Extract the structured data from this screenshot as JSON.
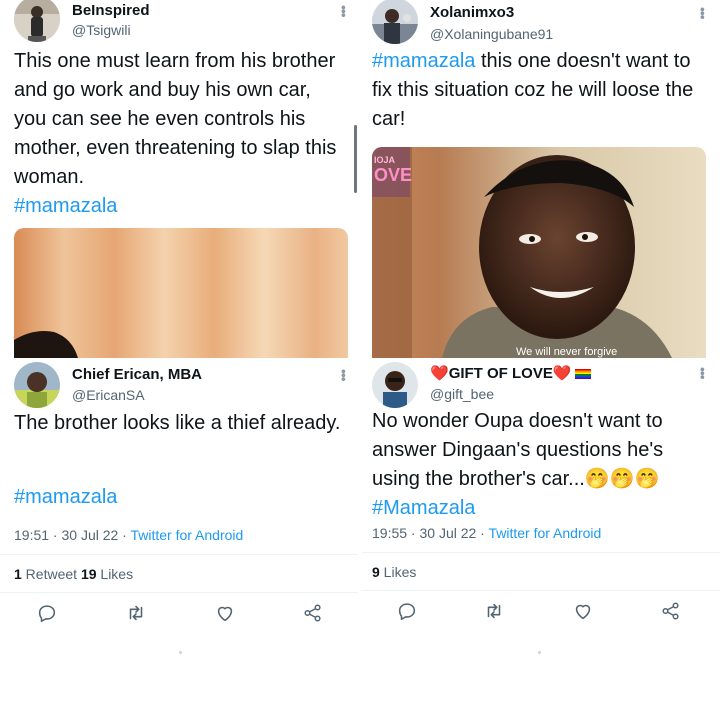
{
  "left": {
    "tweet1": {
      "name": "BeInspired",
      "handle": "@Tsigwili",
      "text": "This one must learn from his brother and go work and buy his own car, you can see he even controls his mother, even threatening to slap this woman.",
      "hashtag": "#mamazala"
    },
    "tweet2": {
      "name": "Chief Erican, MBA",
      "handle": "@EricanSA",
      "text": "The brother looks like a thief already.",
      "hashtag": "#mamazala",
      "time": "19:51 · 30 Jul 22 · ",
      "client": "Twitter for Android",
      "retweets": "1",
      "retweets_label": " Retweet  ",
      "likes": "19",
      "likes_label": " Likes"
    }
  },
  "right": {
    "tweet1": {
      "name": "Xolanimxo3",
      "handle": "@Xolaningubane91",
      "hashtag": "#mamazala",
      "text": " this one doesn't want to fix this situation coz he will loose the car!",
      "video_logo_top": "IOJA",
      "video_logo_bottom": "OVE",
      "video_caption": "We will never forgive"
    },
    "tweet2": {
      "name_prefix": "❤️",
      "name": "GIFT OF LOVE",
      "name_suffix": "❤️",
      "handle": "@gift_bee",
      "text": "No wonder Oupa doesn't want to answer Dingaan's questions he's using the brother's car...",
      "emoji": "🤭🤭🤭",
      "hashtag": "#Mamazala",
      "time": "19:55 · 30 Jul 22 · ",
      "client": "Twitter for Android",
      "likes": "9",
      "likes_label": " Likes"
    }
  },
  "icons": [
    "reply-icon",
    "retweet-icon",
    "like-icon",
    "share-icon",
    "more-icon"
  ],
  "colors": {
    "link": "#1d9bf0",
    "muted": "#536471",
    "text": "#0f1419"
  }
}
